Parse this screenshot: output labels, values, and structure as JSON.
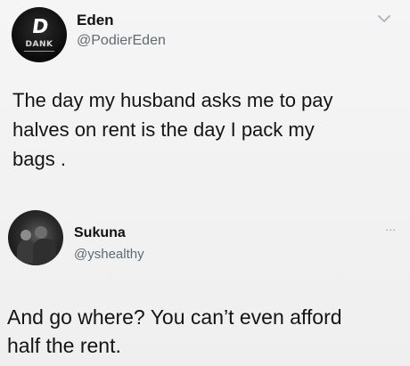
{
  "tweets": [
    {
      "author_name": "Eden",
      "handle": "@PodierEden",
      "avatar_label": "DANK",
      "avatar_logo": "D",
      "text_lines": [
        "The day my husband asks me to pay",
        "halves on rent is the day I pack my",
        "bags ."
      ]
    },
    {
      "author_name": "Sukuna",
      "handle": "@yshealthy",
      "more_glyph": "...",
      "text_lines": [
        "And go where? You can’t even afford",
        "half the rent."
      ]
    }
  ],
  "icons": {
    "tweet1_menu": "chevron-down-icon",
    "tweet2_menu": "more-icon"
  }
}
